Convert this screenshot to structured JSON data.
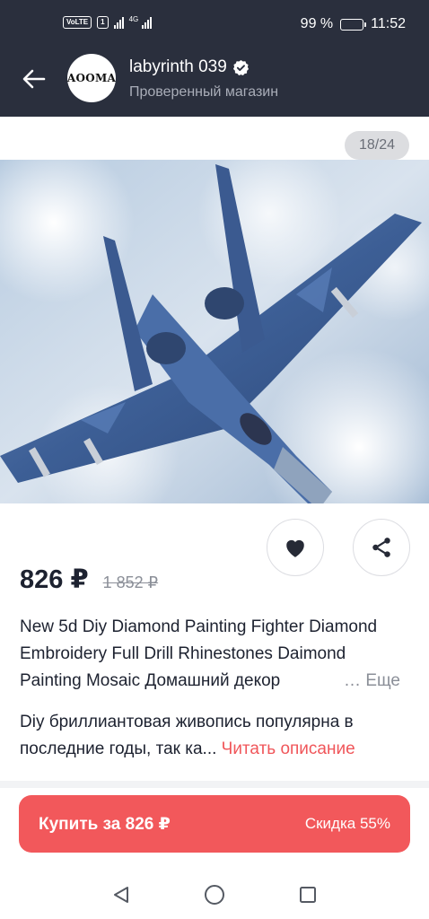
{
  "status_bar": {
    "volte": "VoLTE",
    "sim_number": "1",
    "network": "4G",
    "battery_percent": "99 %",
    "battery_level": 0.99,
    "time": "11:52"
  },
  "header": {
    "back_icon": "arrow-left-icon",
    "avatar_text": "AOOMA",
    "shop_name": "labyrinth 039",
    "verified_icon": "verified-check-icon",
    "shop_subtitle": "Проверенный магазин"
  },
  "gallery": {
    "counter": "18/24"
  },
  "actions": {
    "favorite_icon": "heart-icon",
    "share_icon": "share-icon"
  },
  "product": {
    "price": "826 ₽",
    "old_price": "1 852 ₽",
    "title": "New 5d Diy Diamond Painting Fighter Diamond Embroidery Full Drill Rhinestones Daimond Painting Mosaic Домашний декор",
    "more_label": "Еще",
    "description": "Diy бриллиантовая живопись популярна в последние годы, так ка...",
    "read_description_label": "Читать описание"
  },
  "buy": {
    "label": "Купить за 826 ₽",
    "discount": "Скидка 55%"
  },
  "nav": {
    "back_icon": "triangle-back-icon",
    "home_icon": "circle-home-icon",
    "recents_icon": "square-recents-icon"
  },
  "colors": {
    "header_bg": "#2a2f3d",
    "accent": "#f2585b",
    "link": "#f0565a"
  }
}
